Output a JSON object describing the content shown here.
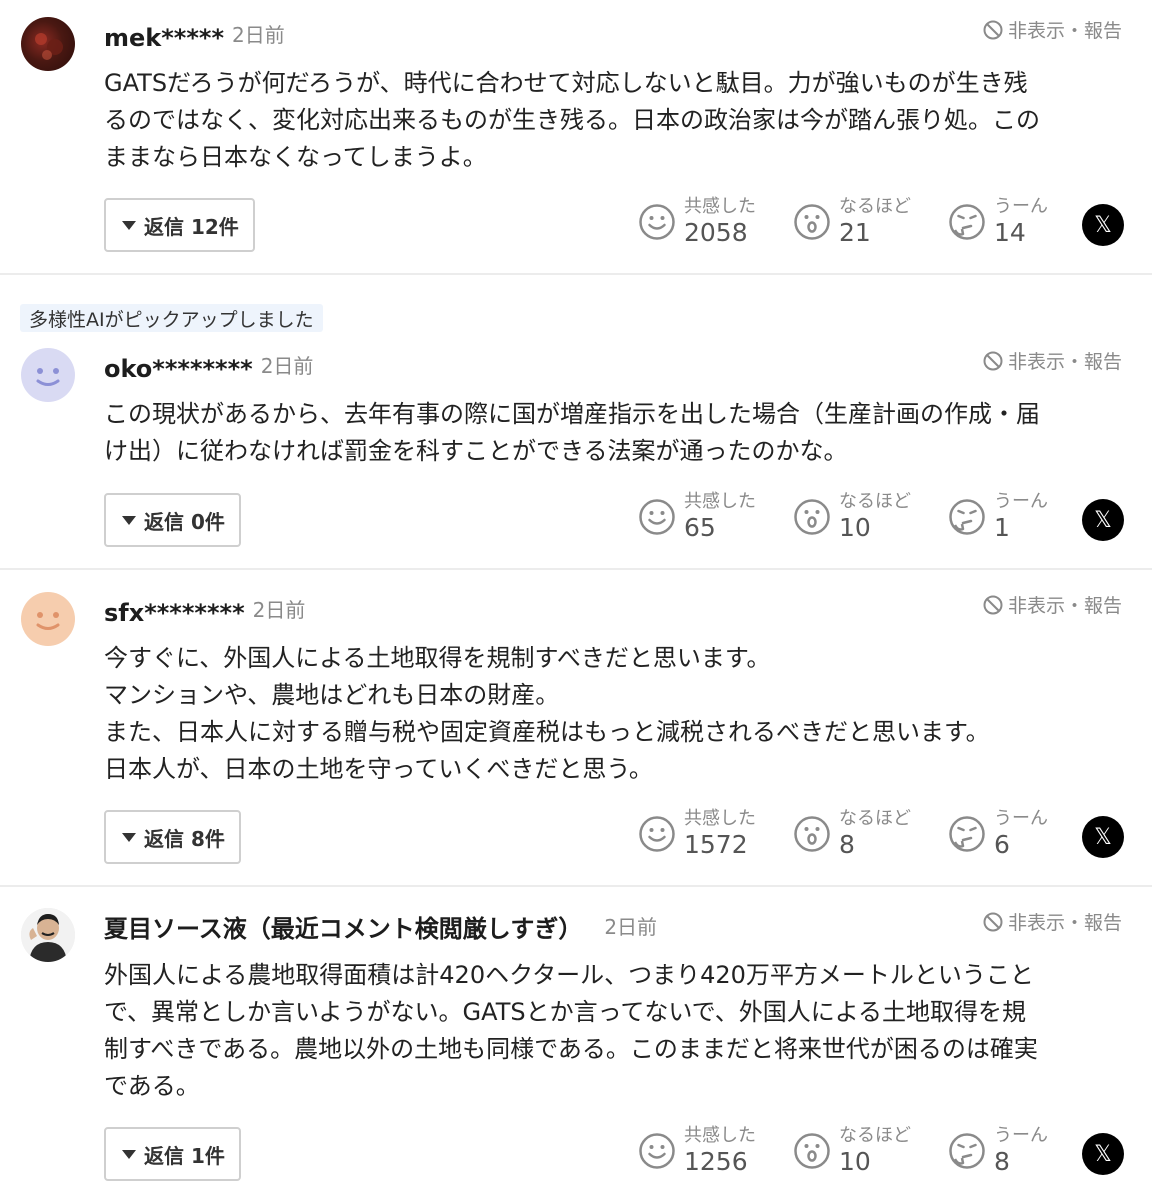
{
  "hide_report_label": "非表示・報告",
  "reaction_labels": {
    "empathy": "共感した",
    "agree": "なるほど",
    "hmm": "うーん"
  },
  "share_icon": "x-logo-icon",
  "ai_pick_badge": "多様性AIがピックアップしました",
  "comments": [
    {
      "user": "mek*****",
      "time": "2日前",
      "body": "GATSだろうが何だろうが、時代に合わせて対応しないと駄目。力が強いものが生き残\nるのではなく、変化対応出来るものが生き残る。日本の政治家は今が踏ん張り処。この\nままなら日本なくなってしまうよ。",
      "reply_label": "返信 12件",
      "empathy": "2058",
      "agree": "21",
      "hmm": "14"
    },
    {
      "user": "oko********",
      "time": "2日前",
      "body": "この現状があるから、去年有事の際に国が増産指示を出した場合（生産計画の作成・届\nけ出）に従わなければ罰金を科すことができる法案が通ったのかな。",
      "reply_label": "返信 0件",
      "empathy": "65",
      "agree": "10",
      "hmm": "1"
    },
    {
      "user": "sfx********",
      "time": "2日前",
      "body": "今すぐに、外国人による土地取得を規制すべきだと思います。\nマンションや、農地はどれも日本の財産。\nまた、日本人に対する贈与税や固定資産税はもっと減税されるべきだと思います。\n日本人が、日本の土地を守っていくべきだと思う。",
      "reply_label": "返信 8件",
      "empathy": "1572",
      "agree": "8",
      "hmm": "6"
    },
    {
      "user": "夏目ソース液（最近コメント検閲厳しすぎ）",
      "time": "2日前",
      "body": "外国人による農地取得面積は計420ヘクタール、つまり420万平方メートルということ\nで、異常としか言いようがない。GATSとか言ってないで、外国人による土地取得を規\n制すべきである。農地以外の土地も同様である。このままだと将来世代が困るのは確実\nである。",
      "reply_label": "返信 1件",
      "empathy": "1256",
      "agree": "10",
      "hmm": "8"
    }
  ]
}
